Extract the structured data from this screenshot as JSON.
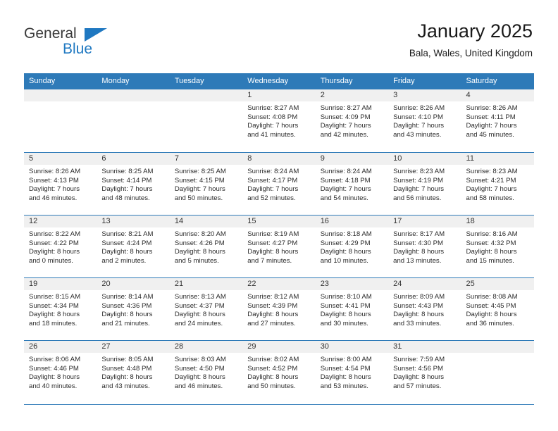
{
  "logo": {
    "word_one": "General",
    "word_two": "Blue",
    "accent_color": "#1f78c1",
    "triangle_icon": "triangle-icon"
  },
  "header": {
    "title": "January 2025",
    "subtitle": "Bala, Wales, United Kingdom"
  },
  "calendar": {
    "header_bg": "#2e7ab8",
    "day_strip_bg": "#f0f0f0",
    "weekdays": [
      "Sunday",
      "Monday",
      "Tuesday",
      "Wednesday",
      "Thursday",
      "Friday",
      "Saturday"
    ],
    "weeks": [
      [
        {
          "day": "",
          "lines": []
        },
        {
          "day": "",
          "lines": []
        },
        {
          "day": "",
          "lines": []
        },
        {
          "day": "1",
          "lines": [
            "Sunrise: 8:27 AM",
            "Sunset: 4:08 PM",
            "Daylight: 7 hours",
            "and 41 minutes."
          ]
        },
        {
          "day": "2",
          "lines": [
            "Sunrise: 8:27 AM",
            "Sunset: 4:09 PM",
            "Daylight: 7 hours",
            "and 42 minutes."
          ]
        },
        {
          "day": "3",
          "lines": [
            "Sunrise: 8:26 AM",
            "Sunset: 4:10 PM",
            "Daylight: 7 hours",
            "and 43 minutes."
          ]
        },
        {
          "day": "4",
          "lines": [
            "Sunrise: 8:26 AM",
            "Sunset: 4:11 PM",
            "Daylight: 7 hours",
            "and 45 minutes."
          ]
        }
      ],
      [
        {
          "day": "5",
          "lines": [
            "Sunrise: 8:26 AM",
            "Sunset: 4:13 PM",
            "Daylight: 7 hours",
            "and 46 minutes."
          ]
        },
        {
          "day": "6",
          "lines": [
            "Sunrise: 8:25 AM",
            "Sunset: 4:14 PM",
            "Daylight: 7 hours",
            "and 48 minutes."
          ]
        },
        {
          "day": "7",
          "lines": [
            "Sunrise: 8:25 AM",
            "Sunset: 4:15 PM",
            "Daylight: 7 hours",
            "and 50 minutes."
          ]
        },
        {
          "day": "8",
          "lines": [
            "Sunrise: 8:24 AM",
            "Sunset: 4:17 PM",
            "Daylight: 7 hours",
            "and 52 minutes."
          ]
        },
        {
          "day": "9",
          "lines": [
            "Sunrise: 8:24 AM",
            "Sunset: 4:18 PM",
            "Daylight: 7 hours",
            "and 54 minutes."
          ]
        },
        {
          "day": "10",
          "lines": [
            "Sunrise: 8:23 AM",
            "Sunset: 4:19 PM",
            "Daylight: 7 hours",
            "and 56 minutes."
          ]
        },
        {
          "day": "11",
          "lines": [
            "Sunrise: 8:23 AM",
            "Sunset: 4:21 PM",
            "Daylight: 7 hours",
            "and 58 minutes."
          ]
        }
      ],
      [
        {
          "day": "12",
          "lines": [
            "Sunrise: 8:22 AM",
            "Sunset: 4:22 PM",
            "Daylight: 8 hours",
            "and 0 minutes."
          ]
        },
        {
          "day": "13",
          "lines": [
            "Sunrise: 8:21 AM",
            "Sunset: 4:24 PM",
            "Daylight: 8 hours",
            "and 2 minutes."
          ]
        },
        {
          "day": "14",
          "lines": [
            "Sunrise: 8:20 AM",
            "Sunset: 4:26 PM",
            "Daylight: 8 hours",
            "and 5 minutes."
          ]
        },
        {
          "day": "15",
          "lines": [
            "Sunrise: 8:19 AM",
            "Sunset: 4:27 PM",
            "Daylight: 8 hours",
            "and 7 minutes."
          ]
        },
        {
          "day": "16",
          "lines": [
            "Sunrise: 8:18 AM",
            "Sunset: 4:29 PM",
            "Daylight: 8 hours",
            "and 10 minutes."
          ]
        },
        {
          "day": "17",
          "lines": [
            "Sunrise: 8:17 AM",
            "Sunset: 4:30 PM",
            "Daylight: 8 hours",
            "and 13 minutes."
          ]
        },
        {
          "day": "18",
          "lines": [
            "Sunrise: 8:16 AM",
            "Sunset: 4:32 PM",
            "Daylight: 8 hours",
            "and 15 minutes."
          ]
        }
      ],
      [
        {
          "day": "19",
          "lines": [
            "Sunrise: 8:15 AM",
            "Sunset: 4:34 PM",
            "Daylight: 8 hours",
            "and 18 minutes."
          ]
        },
        {
          "day": "20",
          "lines": [
            "Sunrise: 8:14 AM",
            "Sunset: 4:36 PM",
            "Daylight: 8 hours",
            "and 21 minutes."
          ]
        },
        {
          "day": "21",
          "lines": [
            "Sunrise: 8:13 AM",
            "Sunset: 4:37 PM",
            "Daylight: 8 hours",
            "and 24 minutes."
          ]
        },
        {
          "day": "22",
          "lines": [
            "Sunrise: 8:12 AM",
            "Sunset: 4:39 PM",
            "Daylight: 8 hours",
            "and 27 minutes."
          ]
        },
        {
          "day": "23",
          "lines": [
            "Sunrise: 8:10 AM",
            "Sunset: 4:41 PM",
            "Daylight: 8 hours",
            "and 30 minutes."
          ]
        },
        {
          "day": "24",
          "lines": [
            "Sunrise: 8:09 AM",
            "Sunset: 4:43 PM",
            "Daylight: 8 hours",
            "and 33 minutes."
          ]
        },
        {
          "day": "25",
          "lines": [
            "Sunrise: 8:08 AM",
            "Sunset: 4:45 PM",
            "Daylight: 8 hours",
            "and 36 minutes."
          ]
        }
      ],
      [
        {
          "day": "26",
          "lines": [
            "Sunrise: 8:06 AM",
            "Sunset: 4:46 PM",
            "Daylight: 8 hours",
            "and 40 minutes."
          ]
        },
        {
          "day": "27",
          "lines": [
            "Sunrise: 8:05 AM",
            "Sunset: 4:48 PM",
            "Daylight: 8 hours",
            "and 43 minutes."
          ]
        },
        {
          "day": "28",
          "lines": [
            "Sunrise: 8:03 AM",
            "Sunset: 4:50 PM",
            "Daylight: 8 hours",
            "and 46 minutes."
          ]
        },
        {
          "day": "29",
          "lines": [
            "Sunrise: 8:02 AM",
            "Sunset: 4:52 PM",
            "Daylight: 8 hours",
            "and 50 minutes."
          ]
        },
        {
          "day": "30",
          "lines": [
            "Sunrise: 8:00 AM",
            "Sunset: 4:54 PM",
            "Daylight: 8 hours",
            "and 53 minutes."
          ]
        },
        {
          "day": "31",
          "lines": [
            "Sunrise: 7:59 AM",
            "Sunset: 4:56 PM",
            "Daylight: 8 hours",
            "and 57 minutes."
          ]
        },
        {
          "day": "",
          "lines": []
        }
      ]
    ]
  }
}
